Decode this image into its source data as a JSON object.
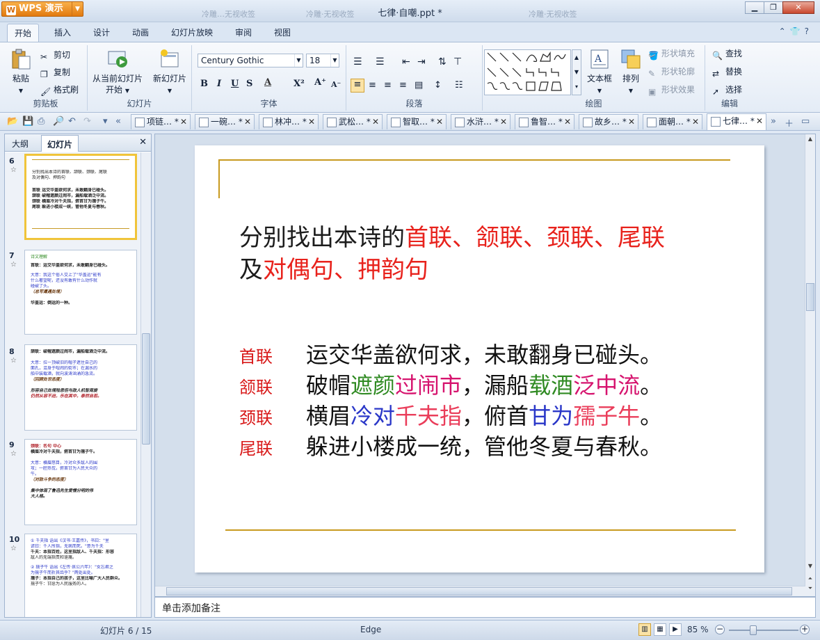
{
  "app": {
    "name": "WPS 演示",
    "doc_title": "七律·自嘲.ppt *"
  },
  "ghost_tabs": [
    "冷雕…无视收签",
    "冷雕·无视收签",
    "冷雕·无视收签"
  ],
  "menu": [
    "开始",
    "插入",
    "设计",
    "动画",
    "幻灯片放映",
    "审阅",
    "视图"
  ],
  "ribbon": {
    "clipboard": {
      "label": "剪贴板",
      "paste": "粘贴",
      "cut": "剪切",
      "copy": "复制",
      "format_painter": "格式刷"
    },
    "slides": {
      "label": "幻灯片",
      "from_current": "从当前幻灯片",
      "start": "开始",
      "new_slide": "新幻灯片"
    },
    "font": {
      "label": "字体",
      "name": "Century Gothic",
      "size": "18"
    },
    "paragraph": {
      "label": "段落"
    },
    "drawing": {
      "label": "绘图",
      "textbox": "文本框",
      "arrange": "排列",
      "fill": "形状填充",
      "outline": "形状轮廓",
      "effect": "形状效果"
    },
    "edit": {
      "label": "编辑",
      "find": "查找",
      "replace": "替换",
      "select": "选择"
    }
  },
  "doc_tabs": [
    "项链… *",
    "一碗… *",
    "林冲… *",
    "武松… *",
    "智取… *",
    "水浒… *",
    "鲁智… *",
    "故乡… *",
    "面朝… *",
    "七律… *"
  ],
  "left_pane": {
    "tabs": [
      "大纲",
      "幻灯片"
    ],
    "thumbnails": [
      {
        "num": "6",
        "lines": [
          "分别找出本诗的首联、颔联、颈联、尾联",
          "及对偶句、押韵句",
          "首联  运交华盖欲何求，未敢翻身已碰头。",
          "颔联  破帽遮颜过闹市，漏船载酒泛中流。",
          "颈联  横眉冷对千夫指，俯首甘为孺子牛。",
          "尾联  躲进小楼成一统，管他冬夏与春秋。"
        ]
      },
      {
        "num": "7",
        "lines": [
          "诗文理解",
          "首联：运交华盖欲何求，未敢翻身已碰头。",
          "大意：我这个俗人交上了\"华盖运\"能有",
          "什么奢望呢，还没有敢有什么动作就",
          "碰破了头。",
          "（总写遭遇处境）",
          "华盖运：倒运的一种。"
        ]
      },
      {
        "num": "8",
        "lines": [
          "颔联：破帽遮颜过闹市，漏船载酒泛中流。",
          "大意：拉一顶破旧的帽子遮住自己的",
          "面孔，混身于喧闹的街市；在漏水的",
          "船中装载酒，就向波涛汹涌的急流。",
          "（回顾处世态度）",
          "形容自己处境险恶但与敌人机智周旋",
          "仍然从容不迫，乐在其中，泰然自若。"
        ]
      },
      {
        "num": "9",
        "lines": [
          "颈联：名句 中心",
          "横眉冷对千夫指，俯首甘为孺子牛。",
          "大意：横眉怒目，冷对众多敌人的围",
          "攻；一腔热忱，俯首甘为人民大众的",
          "牛。",
          "（对敌斗争的态度）",
          "集中体现了鲁迅先生爱憎分明的伟",
          "大人格。"
        ]
      },
      {
        "num": "10",
        "lines": [
          "① 千夫指 语出《汉书·王嘉传》，书曰：\"里",
          "谚曰：千人所指，无病而死。\"意为千夫",
          "千夫：本指百姓，这里指敌人、千夫指：形容",
          "敌人的无端指责和诬蔑。",
          "② 孺子牛 语出《左传·哀公六年》：\"女忘君之",
          "为孺子牛而折其齿乎？\"两处出处。",
          "孺子：本指自己的孩子，这里比喻广大人民群众。",
          "孺子牛：甘愿为人民服务的人。"
        ]
      }
    ]
  },
  "slide": {
    "heading_line1_plain": "分别找出本诗的",
    "heading_line1_red": "首联、颔联、颈联、尾联",
    "heading_line2_plain": "及",
    "heading_line2_red": "对偶句、押韵句",
    "poem": [
      {
        "label": "首联",
        "segments": [
          [
            "运交华盖欲何求，未敢翻身已碰头。",
            "black"
          ]
        ]
      },
      {
        "label": "颔联",
        "segments": [
          [
            "破帽",
            "black"
          ],
          [
            "遮颜",
            "green"
          ],
          [
            "过闹市",
            "magenta"
          ],
          [
            "，漏船",
            "black"
          ],
          [
            "载酒",
            "green"
          ],
          [
            "泛中流",
            "magenta"
          ],
          [
            "。",
            "black"
          ]
        ]
      },
      {
        "label": "颈联",
        "segments": [
          [
            "横眉",
            "black"
          ],
          [
            "冷对",
            "blue"
          ],
          [
            "千夫指",
            "pink"
          ],
          [
            "，俯首",
            "black"
          ],
          [
            "甘为",
            "blue"
          ],
          [
            "孺子牛",
            "pink"
          ],
          [
            "。",
            "black"
          ]
        ]
      },
      {
        "label": "尾联",
        "segments": [
          [
            "躲进小楼成一统，管他冬夏与春秋。",
            "black"
          ]
        ]
      }
    ]
  },
  "notes_placeholder": "单击添加备注",
  "status": {
    "slide_count": "幻灯片 6 / 15",
    "theme": "Edge",
    "zoom": "85 %"
  },
  "colors": {
    "accent_gold": "#c89a1f",
    "red": "#e8221c",
    "green": "#2f8a22",
    "magenta": "#d6136e",
    "blue": "#2a37c8",
    "pink": "#ea3d5a"
  }
}
